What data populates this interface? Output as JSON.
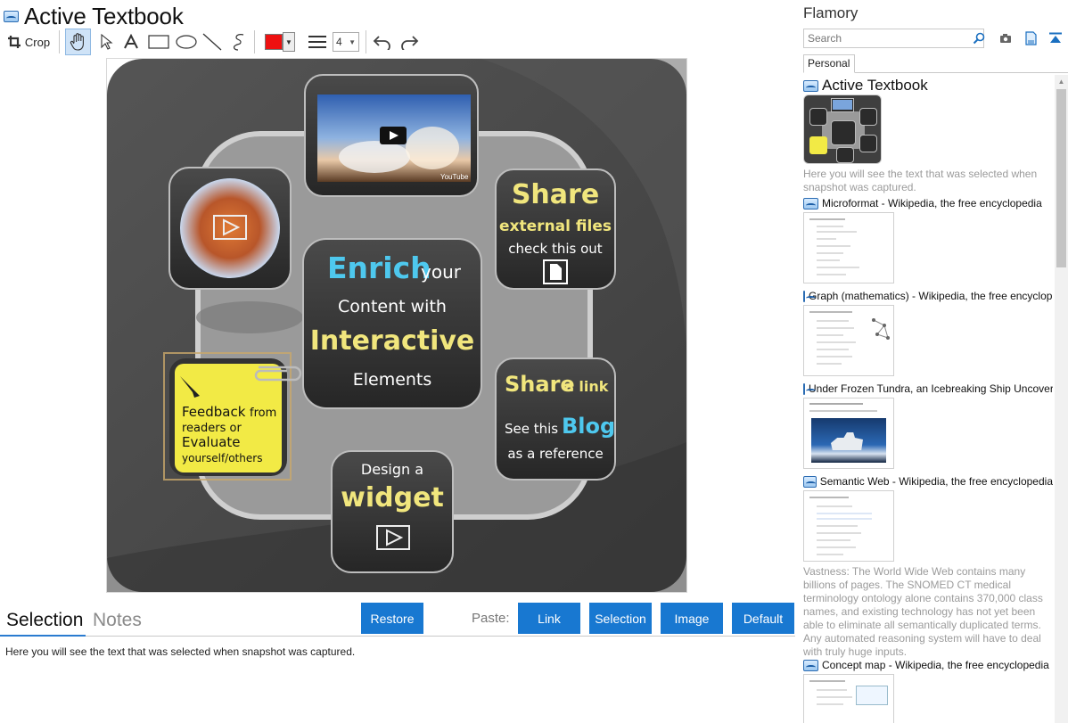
{
  "document": {
    "title": "Active Textbook"
  },
  "toolbar": {
    "crop_label": "Crop",
    "color": "#ee1111",
    "line_width": "4"
  },
  "canvas": {
    "bubble_share_title": "Share",
    "bubble_share_sub": "external files",
    "bubble_share_sub2": "check this out",
    "center_word1": "Enrich",
    "center_word2": "your",
    "center_line2": "Content with",
    "center_line3": "Interactive",
    "center_line4": "Elements",
    "link_title1": "Share",
    "link_title2": "a link",
    "link_line2a": "See this",
    "link_line2b": "Blog",
    "link_line3": "as a reference",
    "widget_line1": "Design a",
    "widget_line2": "widget",
    "feedback_line1": "Feedback",
    "feedback_line1b": "from",
    "feedback_line2": "readers or",
    "feedback_line3": "Evaluate",
    "feedback_line4": "yourself/others",
    "video_brand": "YouTube"
  },
  "bottom": {
    "tab_selection": "Selection",
    "tab_notes": "Notes",
    "restore_button": "Restore",
    "paste_label": "Paste:",
    "paste_link": "Link",
    "paste_selection": "Selection",
    "paste_image": "Image",
    "paste_default": "Default",
    "selection_text": "Here you will see the text that was selected when snapshot was captured."
  },
  "sidebar": {
    "app_name": "Flamory",
    "search_placeholder": "Search",
    "tab_personal": "Personal",
    "items": [
      {
        "label": "Active Textbook",
        "desc": "Here you will see the text that was selected when snapshot was captured."
      },
      {
        "label": "Microformat - Wikipedia, the free encyclopedia"
      },
      {
        "label": "Graph (mathematics) - Wikipedia, the free encyclopedia"
      },
      {
        "label": "Under Frozen Tundra, an Icebreaking Ship Uncovers"
      },
      {
        "label": "Semantic Web - Wikipedia, the free encyclopedia",
        "desc": "Vastness: The World Wide Web contains many billions of pages. The SNOMED CT medical terminology ontology alone contains 370,000 class names, and existing technology has not yet been able to eliminate all semantically duplicated terms. Any automated reasoning system will have to deal with truly huge inputs."
      },
      {
        "label": "Concept map - Wikipedia, the free encyclopedia"
      }
    ]
  },
  "colors": {
    "accent_button": "#1878d1",
    "canvas_dark": "#4a4a4a",
    "note_yellow": "#f2ea45"
  }
}
